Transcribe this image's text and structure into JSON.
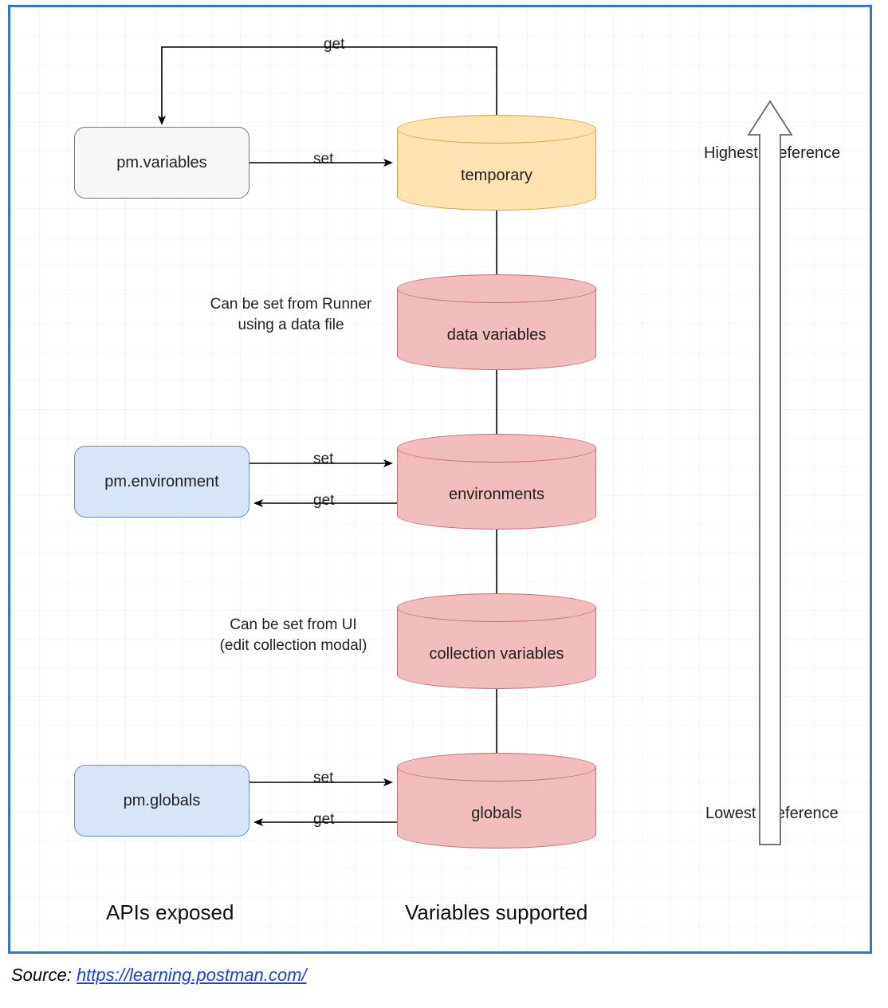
{
  "apis": {
    "variables": "pm.variables",
    "environment": "pm.environment",
    "globals": "pm.globals"
  },
  "scopes": {
    "temporary": "temporary",
    "data": "data variables",
    "environments": "environments",
    "collection": "collection variables",
    "globals": "globals"
  },
  "edge_labels": {
    "get": "get",
    "set": "set"
  },
  "notes": {
    "data": "Can be set from Runner\nusing a data file",
    "collection": "Can be set from UI\n(edit collection modal)"
  },
  "headings": {
    "apis": "APIs exposed",
    "variables": "Variables supported"
  },
  "preference": {
    "highest": "Highest Preference",
    "lowest": "Lowest Preference"
  },
  "source": {
    "prefix": "Source: ",
    "link_text": "https://learning.postman.com/",
    "link_href": "https://learning.postman.com/"
  }
}
